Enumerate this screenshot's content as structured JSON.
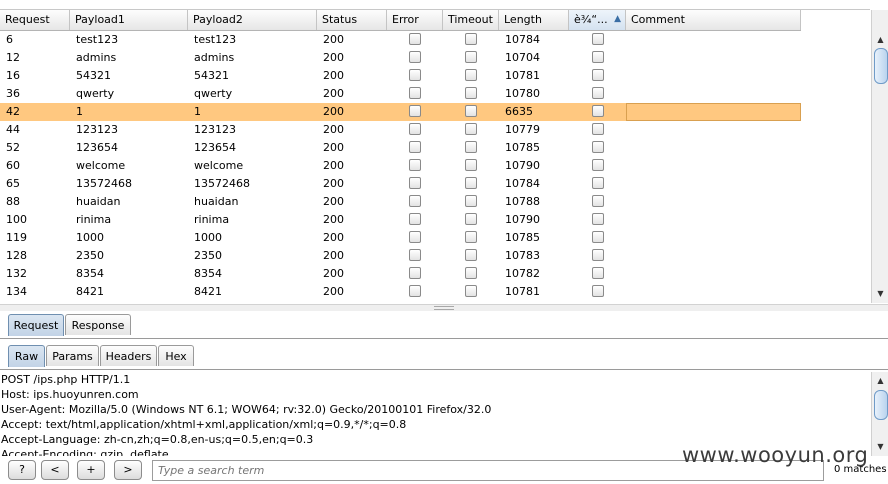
{
  "results": {
    "columns": [
      {
        "label": "Request",
        "width": 70
      },
      {
        "label": "Payload1",
        "width": 118
      },
      {
        "label": "Payload2",
        "width": 129
      },
      {
        "label": "Status",
        "width": 70
      },
      {
        "label": "Error",
        "width": 56
      },
      {
        "label": "Timeout",
        "width": 56
      },
      {
        "label": "Length",
        "width": 70
      },
      {
        "label": "è¾“...",
        "width": 57
      },
      {
        "label": "Comment",
        "width": 175
      }
    ],
    "rows": [
      {
        "request": "6",
        "payload1": "test123",
        "payload2": "test123",
        "status": "200",
        "length": "10784"
      },
      {
        "request": "12",
        "payload1": "admins",
        "payload2": "admins",
        "status": "200",
        "length": "10704"
      },
      {
        "request": "16",
        "payload1": "54321",
        "payload2": "54321",
        "status": "200",
        "length": "10781"
      },
      {
        "request": "36",
        "payload1": "qwerty",
        "payload2": "qwerty",
        "status": "200",
        "length": "10780"
      },
      {
        "request": "42",
        "payload1": "1",
        "payload2": "1",
        "status": "200",
        "length": "6635",
        "selected": true
      },
      {
        "request": "44",
        "payload1": "123123",
        "payload2": "123123",
        "status": "200",
        "length": "10779"
      },
      {
        "request": "52",
        "payload1": "123654",
        "payload2": "123654",
        "status": "200",
        "length": "10785"
      },
      {
        "request": "60",
        "payload1": "welcome",
        "payload2": "welcome",
        "status": "200",
        "length": "10790"
      },
      {
        "request": "65",
        "payload1": "13572468",
        "payload2": "13572468",
        "status": "200",
        "length": "10784"
      },
      {
        "request": "88",
        "payload1": "huaidan",
        "payload2": "huaidan",
        "status": "200",
        "length": "10788"
      },
      {
        "request": "100",
        "payload1": "rinima",
        "payload2": "rinima",
        "status": "200",
        "length": "10790"
      },
      {
        "request": "119",
        "payload1": "1000",
        "payload2": "1000",
        "status": "200",
        "length": "10785"
      },
      {
        "request": "128",
        "payload1": "2350",
        "payload2": "2350",
        "status": "200",
        "length": "10783"
      },
      {
        "request": "132",
        "payload1": "8354",
        "payload2": "8354",
        "status": "200",
        "length": "10782"
      },
      {
        "request": "134",
        "payload1": "8421",
        "payload2": "8421",
        "status": "200",
        "length": "10781"
      }
    ]
  },
  "message_tabs": [
    {
      "label": "Request",
      "active": true
    },
    {
      "label": "Response",
      "active": false
    }
  ],
  "view_tabs": [
    {
      "label": "Raw",
      "active": true
    },
    {
      "label": "Params",
      "active": false
    },
    {
      "label": "Headers",
      "active": false
    },
    {
      "label": "Hex",
      "active": false
    }
  ],
  "raw_lines": [
    "POST /ips.php HTTP/1.1",
    "Host: ips.huoyunren.com",
    "User-Agent: Mozilla/5.0 (Windows NT 6.1; WOW64; rv:32.0) Gecko/20100101 Firefox/32.0",
    "Accept: text/html,application/xhtml+xml,application/xml;q=0.9,*/*;q=0.8",
    "Accept-Language: zh-cn,zh;q=0.8,en-us;q=0.5,en;q=0.3",
    "Accept-Encoding: gzip, deflate"
  ],
  "bottom": {
    "help_label": "?",
    "prev_label": "<",
    "add_label": "+",
    "next_label": ">",
    "search_placeholder": "Type a search term",
    "matches": "0 matches"
  },
  "watermark": "www.wooyun.org",
  "icons": {
    "sort": "triangle-up",
    "scroll_up": "arrow-up",
    "scroll_down": "arrow-down"
  }
}
